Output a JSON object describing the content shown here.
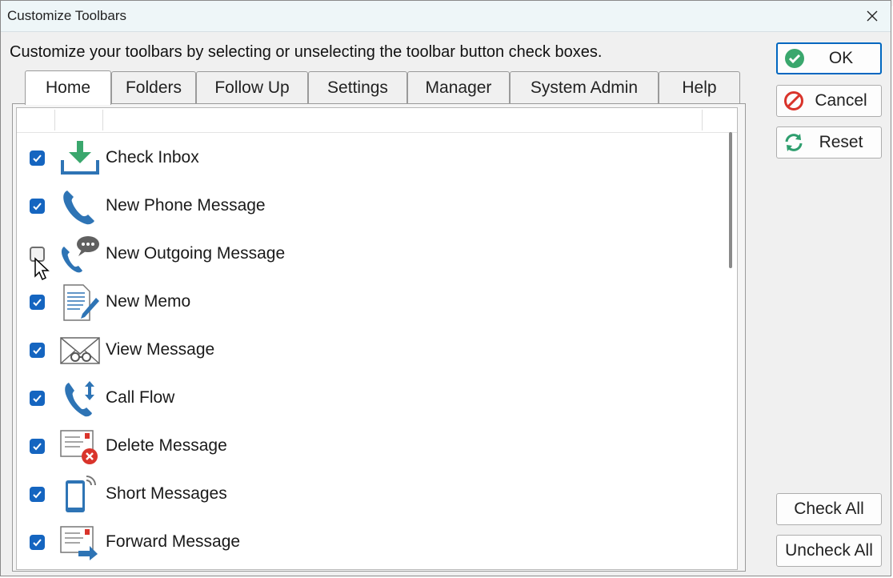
{
  "window": {
    "title": "Customize Toolbars"
  },
  "instructions": "Customize your toolbars by selecting or unselecting the toolbar button check boxes.",
  "tabs": [
    {
      "label": "Home",
      "active": true
    },
    {
      "label": "Folders",
      "active": false
    },
    {
      "label": "Follow Up",
      "active": false
    },
    {
      "label": "Settings",
      "active": false
    },
    {
      "label": "Manager",
      "active": false
    },
    {
      "label": "System Admin",
      "active": false
    },
    {
      "label": "Help",
      "active": false
    }
  ],
  "items": [
    {
      "label": "Check Inbox",
      "checked": true,
      "icon": "inbox-download-icon"
    },
    {
      "label": "New Phone Message",
      "checked": true,
      "icon": "phone-icon"
    },
    {
      "label": "New Outgoing Message",
      "checked": false,
      "icon": "phone-speech-bubble-icon"
    },
    {
      "label": "New Memo",
      "checked": true,
      "icon": "memo-pencil-icon"
    },
    {
      "label": "View Message",
      "checked": true,
      "icon": "envelope-glasses-icon"
    },
    {
      "label": "Call Flow",
      "checked": true,
      "icon": "phone-arrows-icon"
    },
    {
      "label": "Delete Message",
      "checked": true,
      "icon": "message-delete-icon"
    },
    {
      "label": "Short Messages",
      "checked": true,
      "icon": "mobile-phone-icon"
    },
    {
      "label": "Forward Message",
      "checked": true,
      "icon": "message-forward-icon"
    }
  ],
  "buttons": {
    "ok": "OK",
    "cancel": "Cancel",
    "reset": "Reset",
    "check_all": "Check All",
    "uncheck_all": "Uncheck All"
  },
  "colors": {
    "accent": "#1565c0",
    "icon_blue": "#2e74b5",
    "ok_green": "#3aa76d",
    "cancel_red": "#d9342b",
    "reset_green": "#2e9e6e"
  }
}
